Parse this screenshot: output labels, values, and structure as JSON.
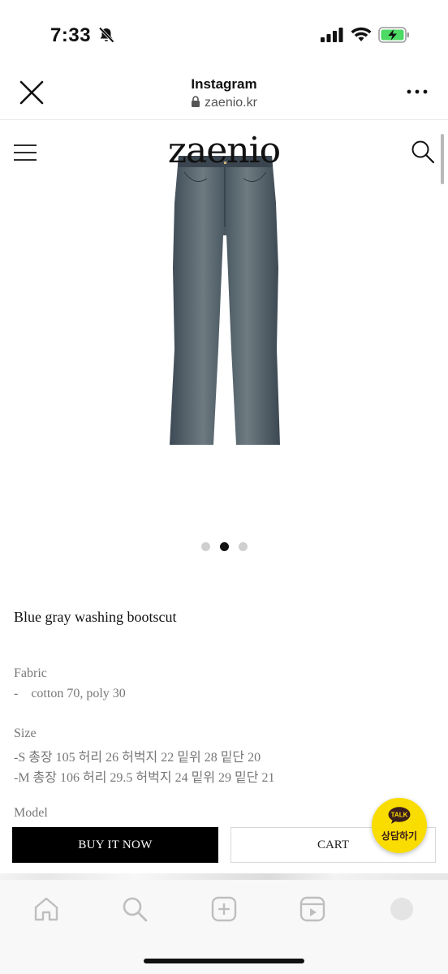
{
  "status_bar": {
    "time": "7:33",
    "battery_color": "#4cd964"
  },
  "browser": {
    "title": "Instagram",
    "url": "zaenio.kr"
  },
  "site": {
    "logo": "zaenio",
    "carousel": {
      "total": 3,
      "active_index": 1
    }
  },
  "product": {
    "title": "Blue gray washing bootscut",
    "fabric_heading": "Fabric",
    "fabric_value": "-    cotton 70, poly 30",
    "size_heading": "Size",
    "size_s": "-S 총장 105 허리 26 허벅지 22 밑위 28 밑단 20",
    "size_m": "-M 총장 106 허리 29.5 허벅지 24 밑위 29 밑단 21",
    "model_heading": "Model"
  },
  "actions": {
    "buy_label": "BUY IT NOW",
    "cart_label": "CART"
  },
  "kakao": {
    "badge": "TALK",
    "label": "상담하기",
    "color": "#f9dc00"
  },
  "tab_bar": {
    "icons": [
      "home-icon",
      "search-icon",
      "plus-icon",
      "reels-icon",
      "profile-icon"
    ]
  }
}
